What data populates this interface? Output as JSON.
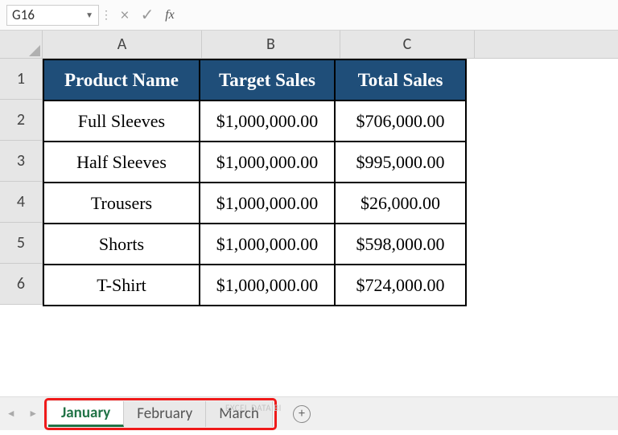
{
  "nameBox": "G16",
  "columns": [
    "A",
    "B",
    "C"
  ],
  "rows": [
    "1",
    "2",
    "3",
    "4",
    "5",
    "6"
  ],
  "table": {
    "headers": [
      "Product Name",
      "Target Sales",
      "Total Sales"
    ],
    "data": [
      {
        "name": "Full Sleeves",
        "target": "$1,000,000.00",
        "total": "$706,000.00"
      },
      {
        "name": "Half Sleeves",
        "target": "$1,000,000.00",
        "total": "$995,000.00"
      },
      {
        "name": "Trousers",
        "target": "$1,000,000.00",
        "total": "$26,000.00"
      },
      {
        "name": "Shorts",
        "target": "$1,000,000.00",
        "total": "$598,000.00"
      },
      {
        "name": "T-Shirt",
        "target": "$1,000,000.00",
        "total": "$724,000.00"
      }
    ]
  },
  "sheets": {
    "tabs": [
      "January",
      "February",
      "March"
    ],
    "active": "January"
  },
  "fx_label": "fx",
  "plus": "+",
  "watermark": "EXCEL DATA BI"
}
